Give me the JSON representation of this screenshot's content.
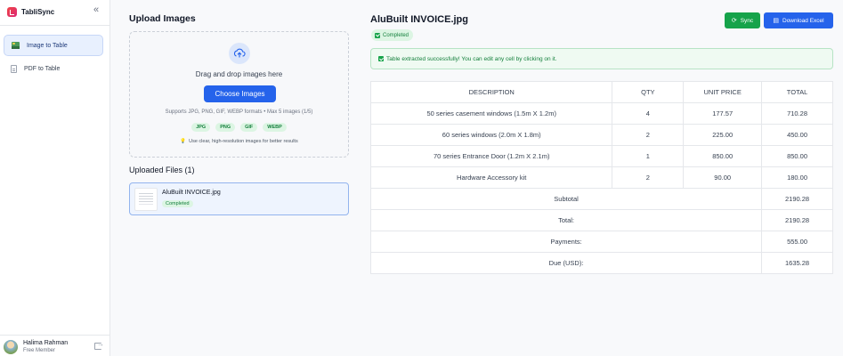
{
  "app": {
    "name": "TabliSync"
  },
  "sidebar": {
    "items": [
      {
        "label": "Image to Table",
        "icon": "image-icon",
        "active": true
      },
      {
        "label": "PDF to Table",
        "icon": "pdf-icon",
        "active": false
      }
    ],
    "user": {
      "name": "Halima Rahman",
      "role": "Free Member"
    }
  },
  "upload": {
    "title": "Upload Images",
    "drop_text": "Drag and drop images here",
    "button_label": "Choose Images",
    "supports": "Supports JPG, PNG, GIF, WEBP formats • Max 5 images (1/5)",
    "formats": [
      "JPG",
      "PNG",
      "GIF",
      "WEBP"
    ],
    "tip": "Use clear, high-resolution images for better results",
    "uploaded_title": "Uploaded Files (1)",
    "files": [
      {
        "name": "AluBuilt INVOICE.jpg",
        "status": "Completed"
      }
    ]
  },
  "result": {
    "title": "AluBuilt INVOICE.jpg",
    "status": "Completed",
    "sync_label": "Sync",
    "download_label": "Download Excel",
    "success_message": "Table extracted successfully! You can edit any cell by clicking on it.",
    "headers": [
      "DESCRIPTION",
      "QTY",
      "UNIT PRICE",
      "TOTAL"
    ],
    "rows": [
      [
        "50 series casement windows (1.5m X 1.2m)",
        "4",
        "177.57",
        "710.28"
      ],
      [
        "60 series windows (2.0m X 1.8m)",
        "2",
        "225.00",
        "450.00"
      ],
      [
        "70 series Entrance Door (1.2m X 2.1m)",
        "1",
        "850.00",
        "850.00"
      ],
      [
        "Hardware Accessory kit",
        "2",
        "90.00",
        "180.00"
      ]
    ],
    "summary": [
      {
        "label": "Subtotal",
        "value": "2190.28"
      },
      {
        "label": "Total:",
        "value": "2190.28"
      },
      {
        "label": "Payments:",
        "value": "555.00"
      },
      {
        "label": "Due (USD):",
        "value": "1635.28"
      }
    ]
  },
  "colors": {
    "primary": "#2563eb",
    "success": "#16a34a"
  }
}
